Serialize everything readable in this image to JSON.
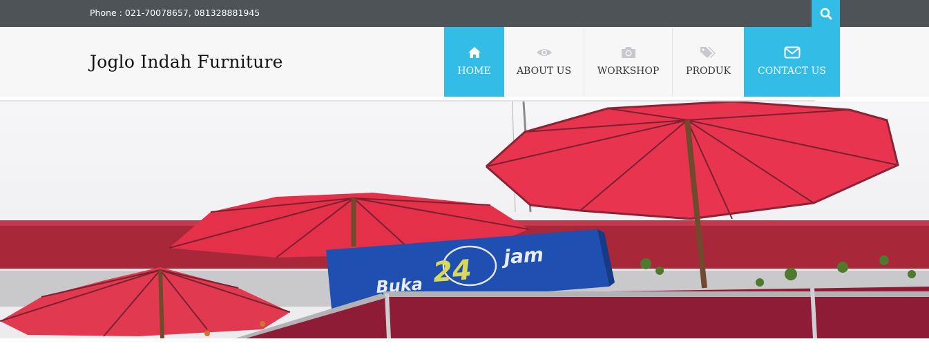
{
  "topbar": {
    "phone": "Phone : 021-70078657, 081328881945",
    "search_icon": "search-icon"
  },
  "header": {
    "site_title": "Joglo Indah Furniture"
  },
  "nav": {
    "items": [
      {
        "label": "HOME",
        "icon": "home-icon",
        "active": true
      },
      {
        "label": "ABOUT US",
        "icon": "eye-icon",
        "active": false
      },
      {
        "label": "WORKSHOP",
        "icon": "camera-icon",
        "active": false
      },
      {
        "label": "PRODUK",
        "icon": "tags-icon",
        "active": false
      },
      {
        "label": "CONTACT US",
        "icon": "envelope-icon",
        "active": true
      }
    ]
  },
  "hero": {
    "sign_text_buka": "Buka",
    "sign_text_24": "24",
    "sign_text_jam": "jam"
  },
  "colors": {
    "topbar": "#4e5358",
    "accent": "#33bde6",
    "header_bg": "#f7f7f7",
    "umbrella_red": "#e8344f"
  }
}
